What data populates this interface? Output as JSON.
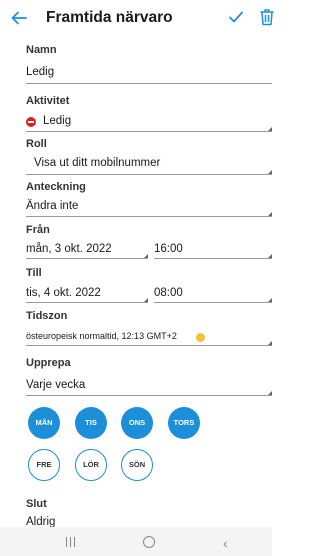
{
  "header": {
    "title": "Framtida närvaro",
    "back_icon": "arrow-left-icon",
    "confirm_icon": "check-icon",
    "delete_icon": "trash-icon",
    "accent": "#1d8fd8"
  },
  "form": {
    "name_label": "Namn",
    "name_value": "Ledig",
    "activity_label": "Aktivitet",
    "activity_value": "Ledig",
    "activity_icon": "do-not-enter-icon",
    "role_label": "Roll",
    "role_value": "Visa ut ditt mobilnummer",
    "note_label": "Anteckning",
    "note_value": "Ändra inte",
    "from_label": "Från",
    "from_date": "mån, 3 okt. 2022",
    "from_time": "16:00",
    "to_label": "Till",
    "to_date": "tis, 4 okt. 2022",
    "to_time": "08:00",
    "timezone_label": "Tidszon",
    "timezone_value": "östeuropeisk normaltid, 12:13  GMT+2",
    "timezone_icon": "smiley-icon",
    "repeat_label": "Upprepa",
    "repeat_value": "Varje vecka",
    "end_label": "Slut",
    "end_value": "Aldrig"
  },
  "days": [
    {
      "label": "MÅN",
      "selected": true
    },
    {
      "label": "TIS",
      "selected": true
    },
    {
      "label": "ONS",
      "selected": true
    },
    {
      "label": "TORS",
      "selected": true
    },
    {
      "label": "FRE",
      "selected": false
    },
    {
      "label": "LÖR",
      "selected": false
    },
    {
      "label": "SÖN",
      "selected": false
    }
  ],
  "navbar": {
    "recent_icon": "recent-apps-icon",
    "home_icon": "home-circle-icon",
    "back_icon": "back-chevron-icon"
  }
}
